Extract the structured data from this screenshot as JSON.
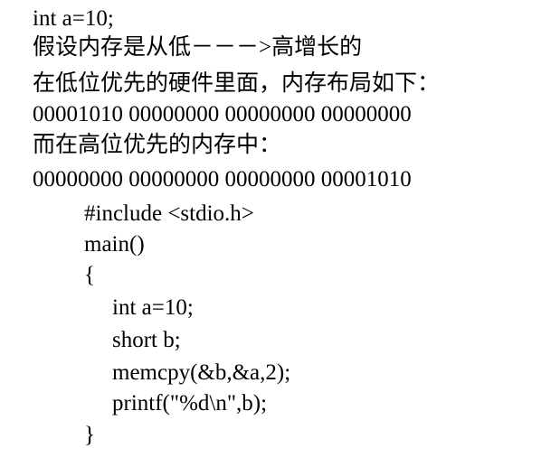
{
  "document": {
    "lines": [
      "int a=10;",
      "假设内存是从低－－－>高增长的",
      "在低位优先的硬件里面，内存布局如下：",
      "00001010 00000000 00000000 00000000",
      "而在高位优先的内存中：",
      "00000000 00000000 00000000 00001010",
      "#include <stdio.h>",
      "main()",
      "{",
      "int a=10;",
      "short b;",
      "memcpy(&b,&a,2);",
      "printf(\"%d\\n\",b);",
      "}"
    ]
  }
}
